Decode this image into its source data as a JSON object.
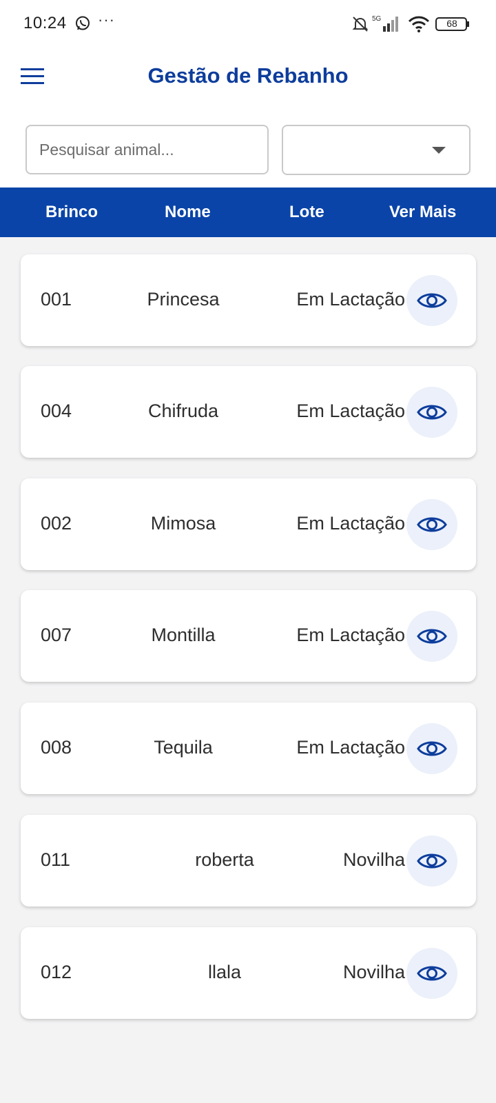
{
  "status_bar": {
    "time": "10:24",
    "dots": "···",
    "battery": "68",
    "network": "5G"
  },
  "app_bar": {
    "title": "Gestão de Rebanho",
    "menu_icon": "hamburger-menu-icon"
  },
  "filters": {
    "search_placeholder": "Pesquisar animal...",
    "lote_selected": "",
    "select_icon": "chevron-down-icon"
  },
  "table": {
    "headers": [
      "Brinco",
      "Nome",
      "Lote",
      "Ver Mais"
    ],
    "rows": [
      {
        "brinco": "001",
        "nome": "Princesa",
        "lote": "Em Lactação"
      },
      {
        "brinco": "004",
        "nome": "Chifruda",
        "lote": "Em Lactação"
      },
      {
        "brinco": "002",
        "nome": "Mimosa",
        "lote": "Em Lactação"
      },
      {
        "brinco": "007",
        "nome": "Montilla",
        "lote": "Em Lactação"
      },
      {
        "brinco": "008",
        "nome": "Tequila",
        "lote": "Em Lactação"
      },
      {
        "brinco": "011",
        "nome": "roberta",
        "lote": "Novilha"
      },
      {
        "brinco": "012",
        "nome": "llala",
        "lote": "Novilha"
      }
    ],
    "action_icon": "eye-icon"
  },
  "colors": {
    "primary": "#0a44a8",
    "title": "#0d3d9c",
    "eye_bg": "#ebf0fa",
    "page_bg": "#f3f3f4"
  }
}
